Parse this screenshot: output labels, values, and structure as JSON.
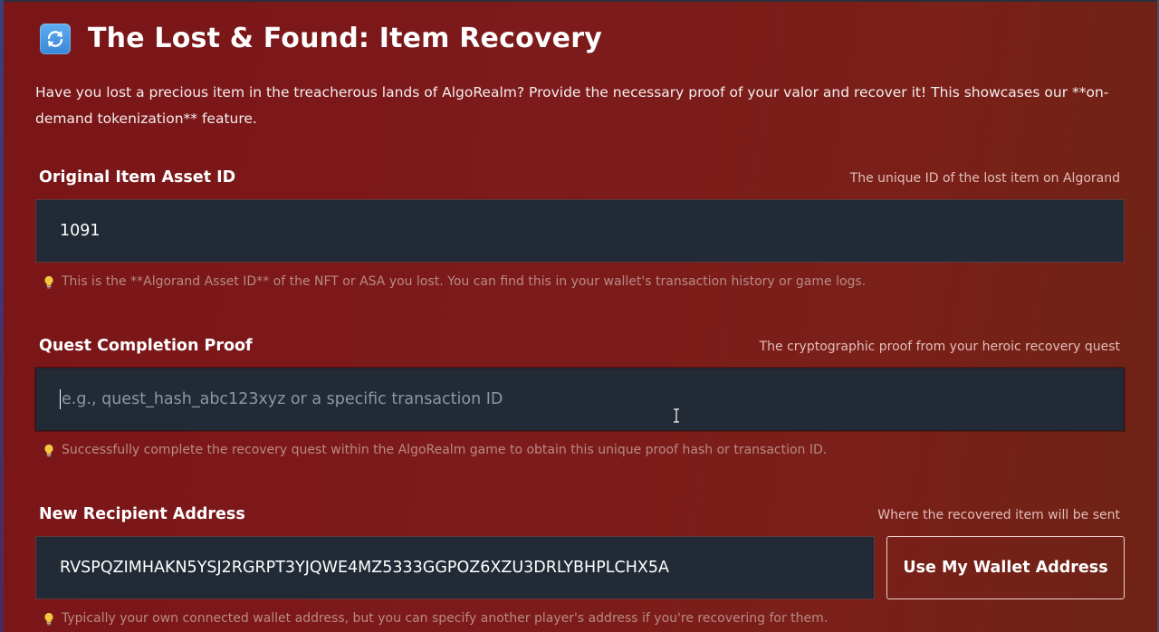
{
  "header": {
    "icon": "refresh-arrows-icon",
    "title": "The Lost & Found: Item Recovery"
  },
  "intro": {
    "text": "Have you lost a precious item in the treacherous lands of AlgoRealm? Provide the necessary proof of your valor and recover it! This showcases our **on-demand tokenization** feature."
  },
  "fields": {
    "asset_id": {
      "label": "Original Item Asset ID",
      "sublabel": "The unique ID of the lost item on Algorand",
      "value": "1091",
      "hint_icon": "lightbulb-icon",
      "hint": "This is the **Algorand Asset ID** of the NFT or ASA you lost. You can find this in your wallet's transaction history or game logs."
    },
    "quest_proof": {
      "label": "Quest Completion Proof",
      "sublabel": "The cryptographic proof from your heroic recovery quest",
      "value": "",
      "placeholder": "e.g., quest_hash_abc123xyz or a specific transaction ID",
      "hint_icon": "lightbulb-icon",
      "hint": "Successfully complete the recovery quest within the AlgoRealm game to obtain this unique proof hash or transaction ID."
    },
    "recipient": {
      "label": "New Recipient Address",
      "sublabel": "Where the recovered item will be sent",
      "value": "RVSPQZIMHAKN5YSJ2RGRPT3YJQWE4MZ5333GGPOZ6XZU3DRLYBHPLCHX5A",
      "button_label": "Use My Wallet Address",
      "hint_icon": "lightbulb-icon",
      "hint": "Typically your own connected wallet address, but you can specify another player's address if you're recovering for them."
    }
  },
  "colors": {
    "background": "#7a1a1a",
    "input_background": "#212a35",
    "hint_text": "#b98a86",
    "sublabel_text": "#e2bdb9",
    "icon_blue": "#4a9ae6",
    "bulb_yellow": "#f5c842"
  }
}
